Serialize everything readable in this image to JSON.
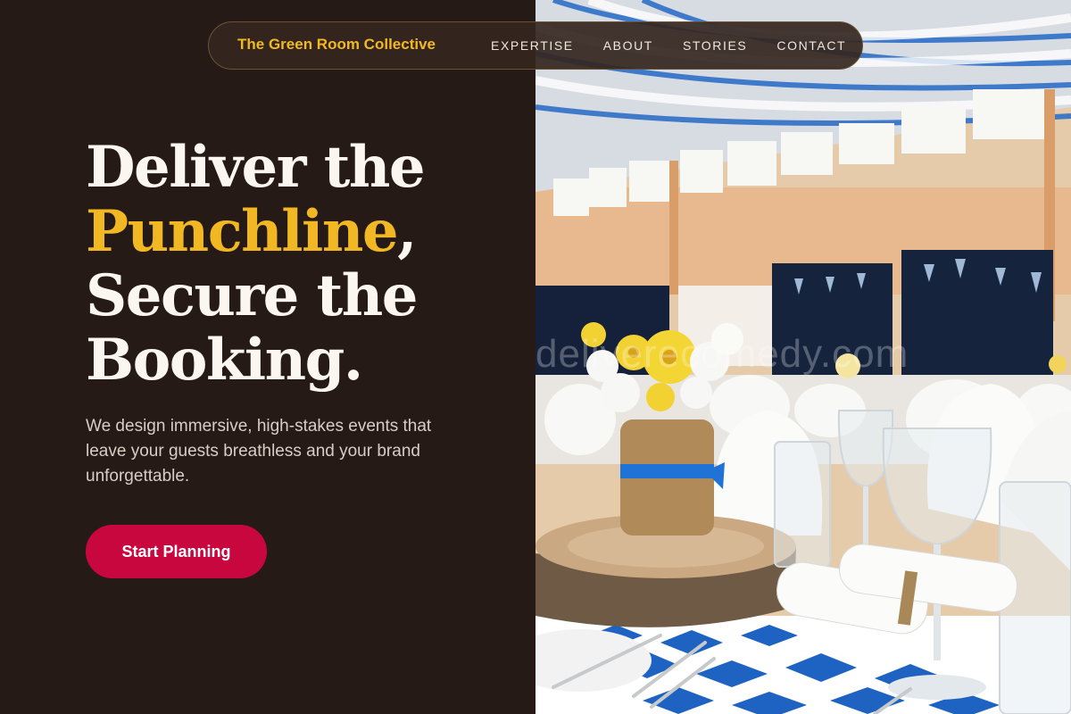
{
  "nav": {
    "brand": "The Green Room Collective",
    "links": [
      {
        "label": "EXPERTISE"
      },
      {
        "label": "ABOUT"
      },
      {
        "label": "STORIES"
      },
      {
        "label": "CONTACT"
      }
    ]
  },
  "hero": {
    "headline_line1": "Deliver the",
    "headline_accent": "Punchline",
    "headline_accent_suffix": ",",
    "headline_line3": "Secure the",
    "headline_line4": "Booking.",
    "subcopy": "We design immersive, high-stakes events that leave your guests breathless and your brand unforgettable.",
    "cta_label": "Start Planning"
  },
  "photo": {
    "watermark_text": "deliverecomedy.com"
  },
  "colors": {
    "background": "#261a17",
    "accent_gold": "#f2b824",
    "cta_red": "#c8073f",
    "nav_border": "#6b5233"
  }
}
